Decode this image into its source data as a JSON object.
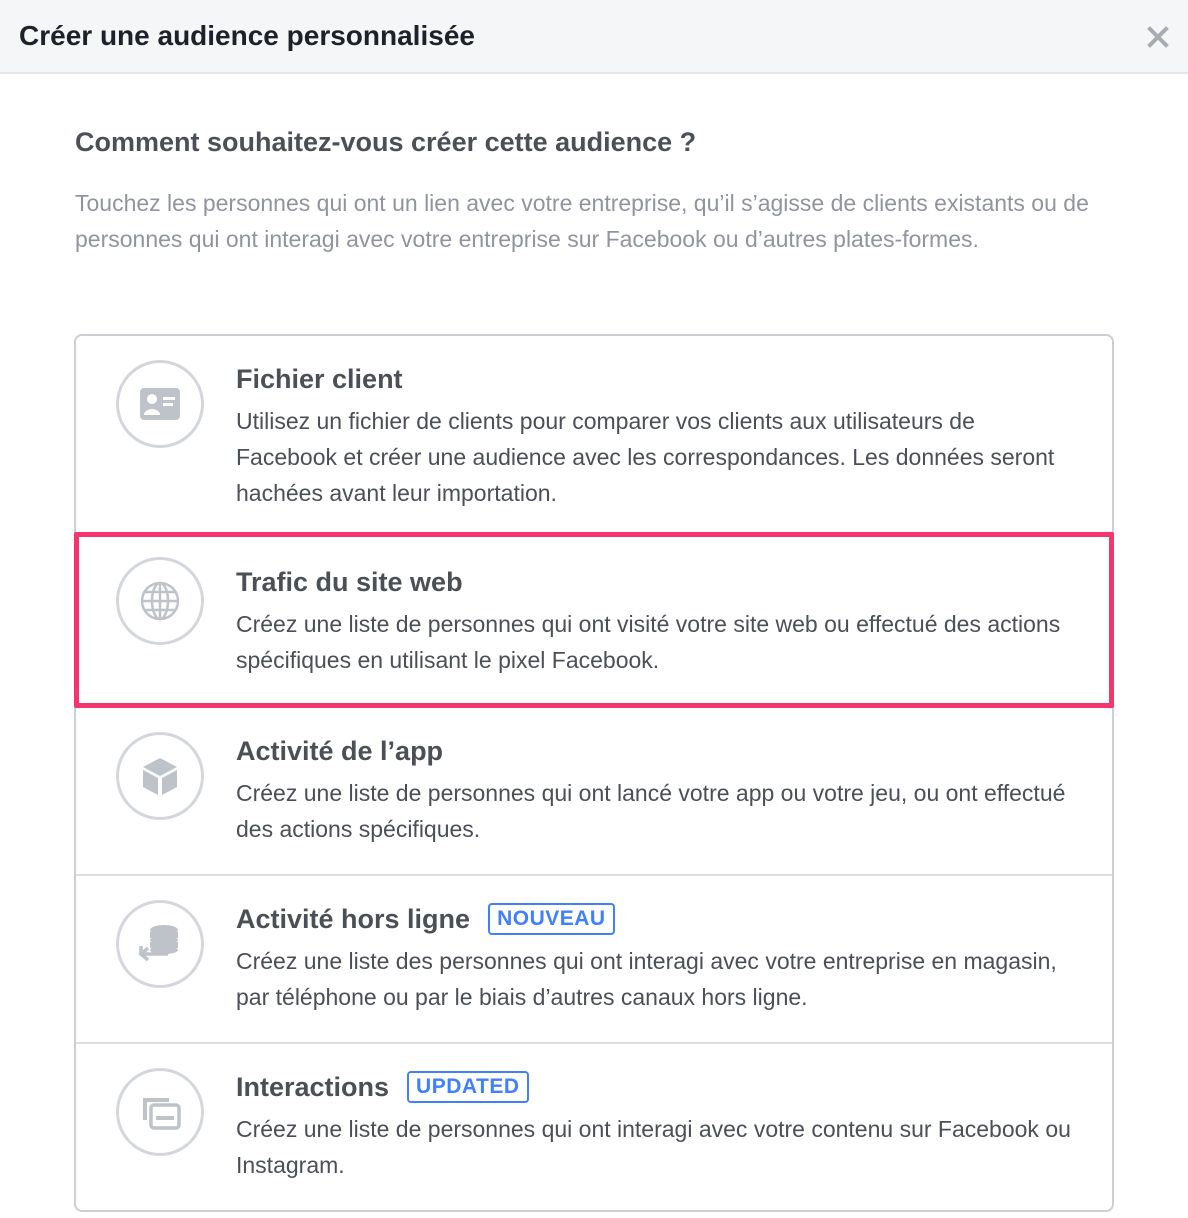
{
  "dialog": {
    "title": "Créer une audience personnalisée",
    "close_icon": "close-icon"
  },
  "main": {
    "question": "Comment souhaitez-vous créer cette audience ?",
    "intro": "Touchez les personnes qui ont un lien avec votre entreprise, qu’il s’agisse de clients existants ou de personnes qui ont interagi avec votre entreprise sur Facebook ou d’autres plates-formes."
  },
  "options": [
    {
      "title": "Fichier client",
      "description": "Utilisez un fichier de clients pour comparer vos clients aux utilisateurs de Facebook et créer une audience avec les correspondances. Les données seront hachées avant leur importation.",
      "icon": "contact-card-icon",
      "badge": null
    },
    {
      "title": "Trafic du site web",
      "description": "Créez une liste de personnes qui ont visité votre site web ou effectué des actions spécifiques en utilisant le pixel Facebook.",
      "icon": "globe-icon",
      "badge": null,
      "highlighted": true
    },
    {
      "title": "Activité de l’app",
      "description": "Créez une liste de personnes qui ont lancé votre app ou votre jeu, ou ont effectué des actions spécifiques.",
      "icon": "cube-icon",
      "badge": null
    },
    {
      "title": "Activité hors ligne",
      "description": "Créez une liste des personnes qui ont interagi avec votre entreprise en magasin, par téléphone ou par le biais d’autres canaux hors ligne.",
      "icon": "offline-sync-icon",
      "badge": "NOUVEAU"
    },
    {
      "title": "Interactions",
      "description": "Créez une liste de personnes qui ont interagi avec votre contenu sur Facebook ou Instagram.",
      "icon": "stacked-cards-icon",
      "badge": "UPDATED"
    }
  ],
  "colors": {
    "highlight_border": "#f5356e",
    "badge_blue": "#4080ff",
    "icon_gray": "#bec2c9"
  }
}
